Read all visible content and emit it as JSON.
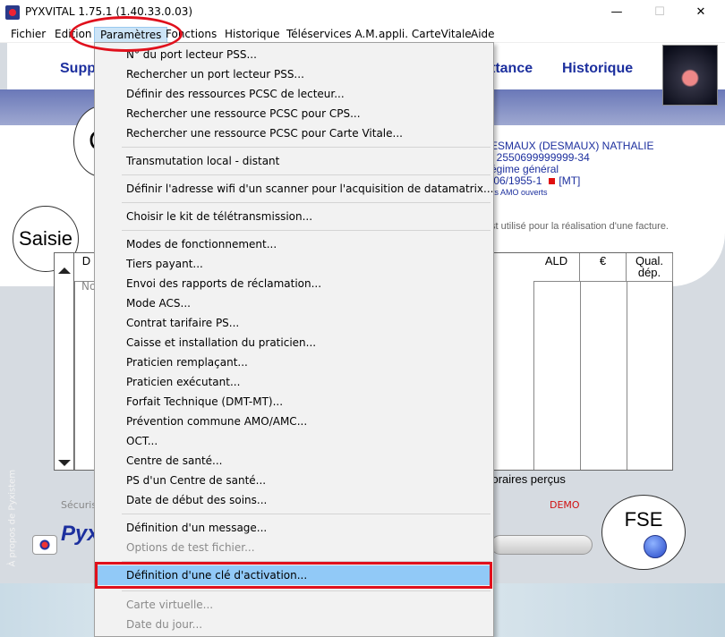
{
  "window": {
    "title": "PYXVITAL 1.75.1 (1.40.33.0.03)",
    "minimize": "—",
    "maximize": "☐",
    "close": "✕"
  },
  "menubar": {
    "items": [
      "Fichier",
      "Edition",
      "Paramètres",
      "Fonctions",
      "Historique",
      "Téléservices A.M.",
      "appli. CarteVitale",
      "Aide"
    ],
    "active": "Paramètres"
  },
  "header": {
    "nav_support": "Supp",
    "nav_quittance": "ttance",
    "nav_historique": "Historique"
  },
  "patient": {
    "name": "ESMAUX (DESMAUX) NATHALIE",
    "nir": ": 2550699999999-34",
    "regime": "égime général",
    "birth": "/06/1955-1",
    "marker": "[MT]",
    "droits": "its AMO ouverts"
  },
  "hint": "st utilisé pour la réalisation d'une facture.",
  "circles": {
    "top_left": "C",
    "saisie": "Saisie",
    "fse": "FSE"
  },
  "table": {
    "columns": [
      "D",
      "ALD",
      "€",
      "Qual.\ndép."
    ],
    "row_hint": "No",
    "footer": "onoraires perçus"
  },
  "bottom": {
    "secu": "Sécuris",
    "demo": "DEMO",
    "brand": "Pyx",
    "vertical_link": "À propos de Pyxistem"
  },
  "dropdown": {
    "items": [
      {
        "label": "N° du port lecteur PSS...",
        "disabled": false
      },
      {
        "label": "Rechercher un port lecteur PSS...",
        "disabled": false
      },
      {
        "label": "Définir des ressources PCSC de lecteur...",
        "disabled": false
      },
      {
        "label": "Rechercher une ressource PCSC pour CPS...",
        "disabled": false
      },
      {
        "label": "Rechercher une ressource PCSC pour Carte Vitale...",
        "disabled": false
      },
      {
        "label": "Transmutation local - distant",
        "disabled": false
      },
      {
        "label": "Définir l'adresse wifi d'un scanner pour l'acquisition de datamatrix...",
        "disabled": false
      },
      {
        "label": "Choisir le kit de télétransmission...",
        "disabled": false
      },
      {
        "label": "Modes de fonctionnement...",
        "disabled": false
      },
      {
        "label": "Tiers payant...",
        "disabled": false
      },
      {
        "label": "Envoi des rapports de réclamation...",
        "disabled": false
      },
      {
        "label": "Mode ACS...",
        "disabled": false
      },
      {
        "label": "Contrat tarifaire PS...",
        "disabled": false
      },
      {
        "label": "Caisse et installation du praticien...",
        "disabled": false
      },
      {
        "label": "Praticien remplaçant...",
        "disabled": false
      },
      {
        "label": "Praticien exécutant...",
        "disabled": false
      },
      {
        "label": "Forfait Technique (DMT-MT)...",
        "disabled": false
      },
      {
        "label": "Prévention commune AMO/AMC...",
        "disabled": false
      },
      {
        "label": "OCT...",
        "disabled": false
      },
      {
        "label": "Centre de santé...",
        "disabled": false
      },
      {
        "label": "PS d'un Centre de santé...",
        "disabled": false
      },
      {
        "label": "Date de début des soins...",
        "disabled": false
      },
      {
        "label": "Définition d'un message...",
        "disabled": false
      },
      {
        "label": "Options de test fichier...",
        "disabled": true
      },
      {
        "label": "Définition d'une clé d'activation...",
        "disabled": false
      },
      {
        "label": "Carte virtuelle...",
        "disabled": true
      },
      {
        "label": "Date du jour...",
        "disabled": true
      }
    ],
    "highlighted": "Définition d'une clé d'activation..."
  },
  "colors": {
    "accent": "#1c2f9e",
    "annotation": "#e0101c",
    "highlight": "#91c9f7"
  }
}
